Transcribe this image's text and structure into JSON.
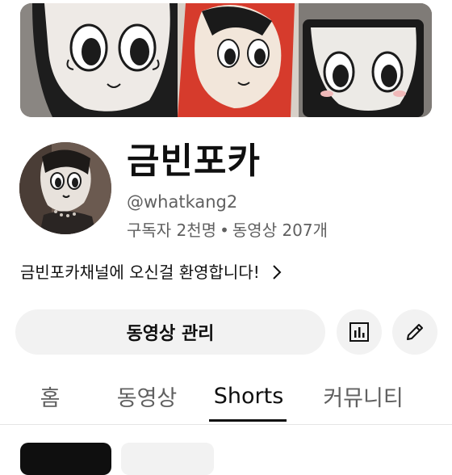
{
  "channel": {
    "name": "금빈포카",
    "handle": "@whatkang2",
    "subscribers": "구독자 2천명",
    "separator": "•",
    "videos": "동영상 207개",
    "description": "금빈포카채널에 오신걸 환영합니다!"
  },
  "actions": {
    "manage_label": "동영상 관리",
    "analytics_icon": "bar-chart-icon",
    "edit_icon": "pencil-icon"
  },
  "tabs": [
    {
      "label": "홈",
      "active": false
    },
    {
      "label": "동영상",
      "active": false
    },
    {
      "label": "Shorts",
      "active": true
    },
    {
      "label": "커뮤니티",
      "active": false
    }
  ],
  "colors": {
    "text_primary": "#0f0f0f",
    "text_secondary": "#606060",
    "button_bg": "#f2f2f2",
    "chip_selected": "#0f0f0f",
    "chip_unselected": "#f2f2f2"
  }
}
